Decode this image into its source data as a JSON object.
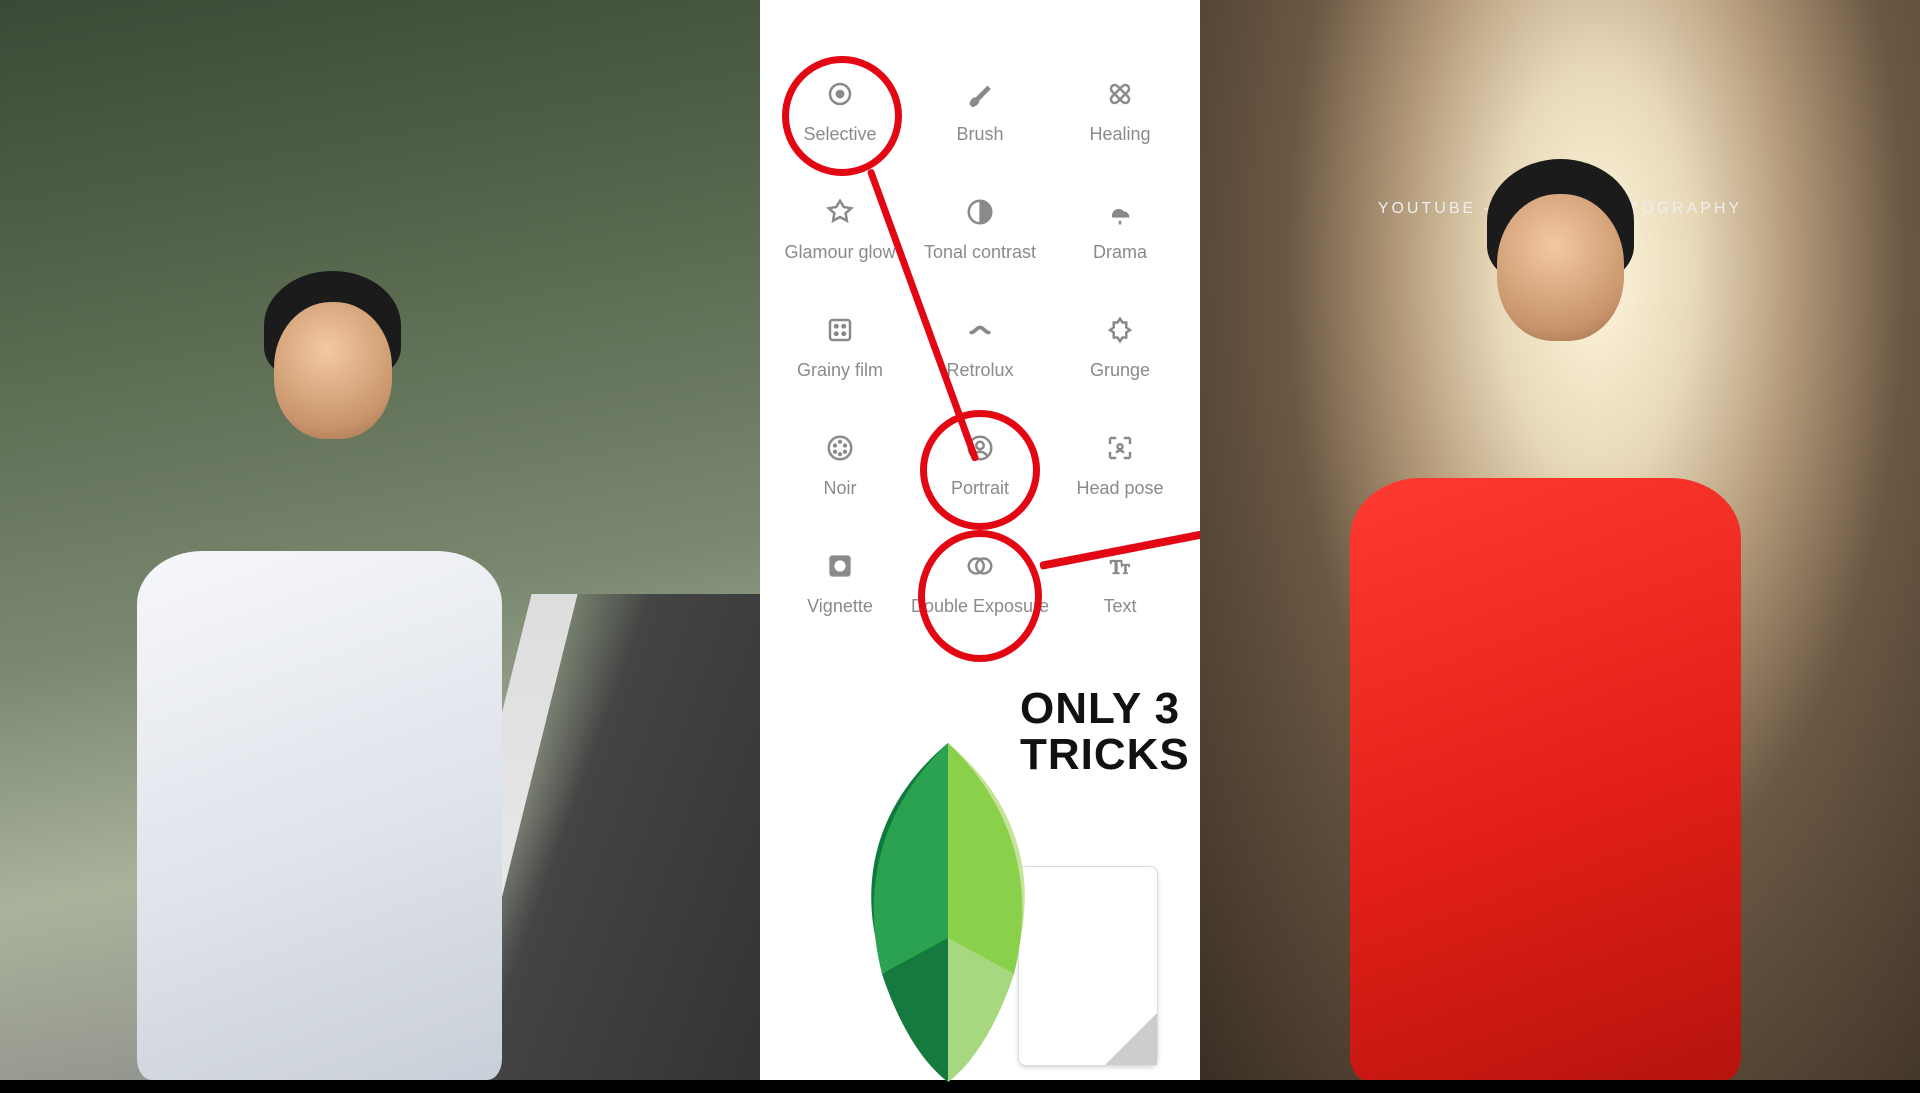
{
  "thumbnail": {
    "only3_line1": "ONLY 3",
    "only3_line2": "TRICKS",
    "watermark": "YOUTUBE - YOGESH EDITOGRAPHY"
  },
  "snapseed_tools": {
    "selective": "Selective",
    "brush": "Brush",
    "healing": "Healing",
    "glamour_glow": "Glamour glow",
    "tonal_contrast": "Tonal contrast",
    "drama": "Drama",
    "grainy_film": "Grainy film",
    "retrolux": "Retrolux",
    "grunge": "Grunge",
    "noir": "Noir",
    "portrait": "Portrait",
    "head_pose": "Head pose",
    "vignette": "Vignette",
    "double_exposure": "Double Exposure",
    "text": "Text"
  },
  "highlighted_tools": [
    "selective",
    "portrait",
    "double_exposure"
  ]
}
